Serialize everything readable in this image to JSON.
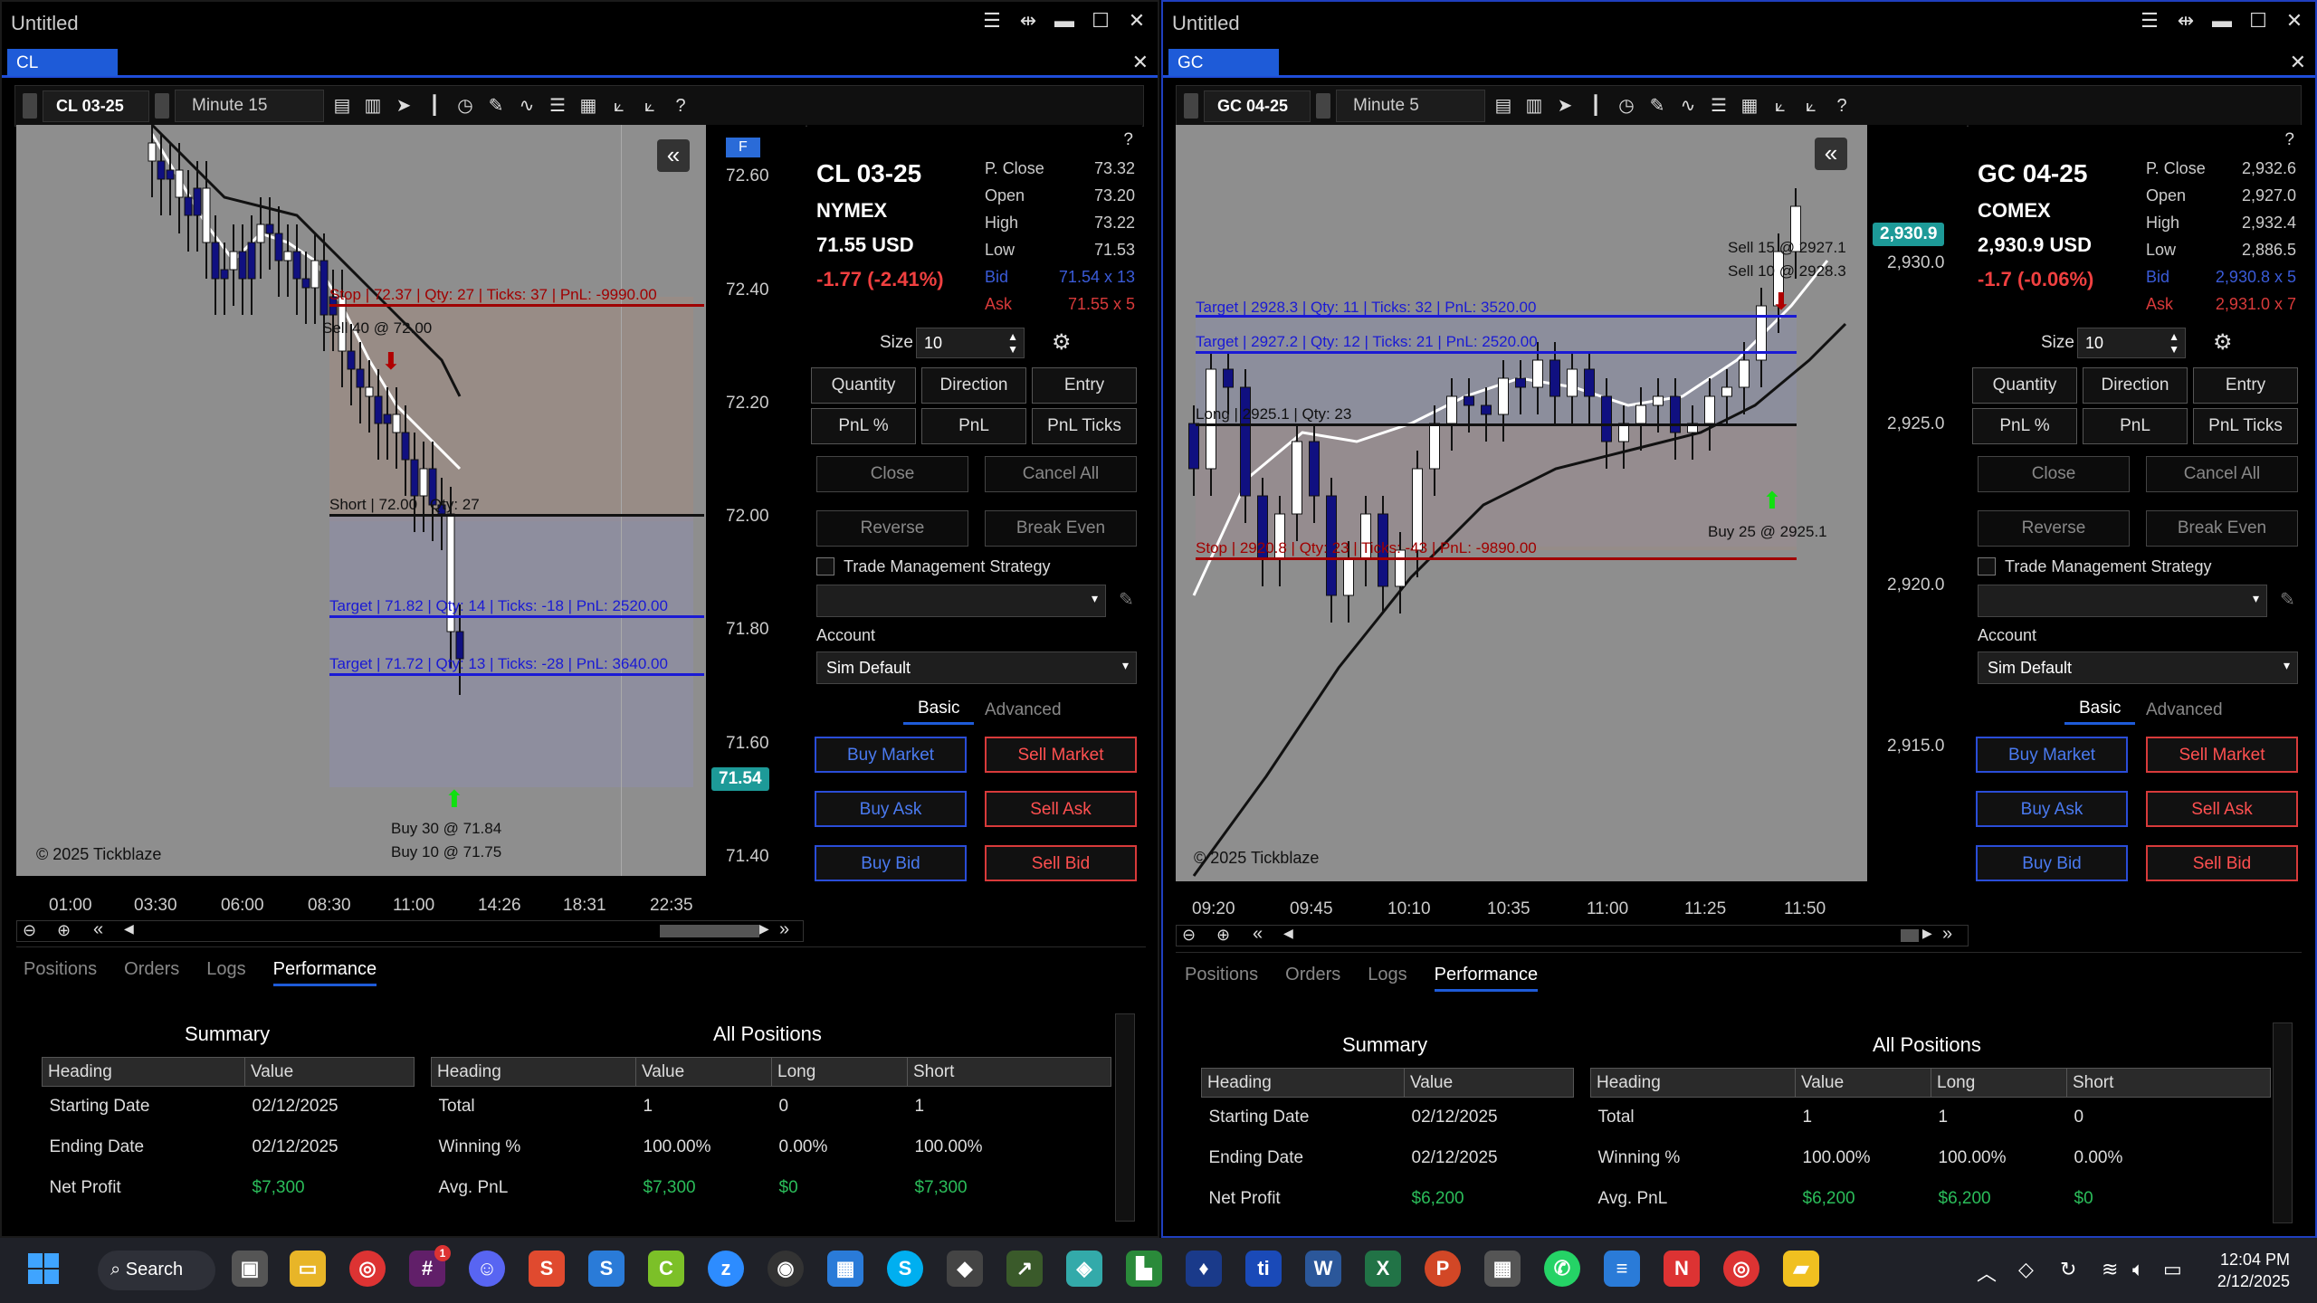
{
  "left": {
    "title": "Untitled",
    "tab": "CL",
    "instrument": "CL 03-25",
    "timeframe": "Minute 15",
    "chart": {
      "f_button": "F",
      "y_ticks": [
        "72.60",
        "72.40",
        "72.20",
        "72.00",
        "71.80",
        "71.60",
        "71.40"
      ],
      "x_ticks": [
        "01:00",
        "03:30",
        "06:00",
        "08:30",
        "11:00",
        "14:26",
        "18:31",
        "22:35"
      ],
      "price_tag": "71.54",
      "copyright": "© 2025 Tickblaze",
      "stop_label": "Stop | 72.37 | Qty: 27 | Ticks: 37 | PnL: -9990.00",
      "sell_label": "Sell 40 @ 72.00",
      "short_label": "Short | 72.00 | Qty: 27",
      "target1_label": "Target | 71.82 | Qty: 14 | Ticks: -18 | PnL: 2520.00",
      "target2_label": "Target | 71.72 | Qty: 13 | Ticks: -28 | PnL: 3640.00",
      "buy1_label": "Buy 30 @ 71.84",
      "buy2_label": "Buy 10 @ 71.75"
    },
    "panel": {
      "symbol": "CL 03-25",
      "exchange": "NYMEX",
      "price": "71.55 USD",
      "change": "-1.77 (-2.41%)",
      "quotes": [
        {
          "k": "P. Close",
          "v": "73.32"
        },
        {
          "k": "Open",
          "v": "73.20"
        },
        {
          "k": "High",
          "v": "73.22"
        },
        {
          "k": "Low",
          "v": "71.53"
        },
        {
          "k": "Bid",
          "v": "71.54 x 13"
        },
        {
          "k": "Ask",
          "v": "71.55 x 5"
        }
      ],
      "size_label": "Size",
      "size_value": "10",
      "account_value": "Sim Default"
    },
    "bottom": {
      "summary_rows": [
        {
          "h": "Starting Date",
          "v": "02/12/2025"
        },
        {
          "h": "Ending Date",
          "v": "02/12/2025"
        },
        {
          "h": "Net Profit",
          "v": "$7,300"
        }
      ],
      "positions_rows": [
        {
          "h": "Total",
          "v": "1",
          "l": "0",
          "s": "1"
        },
        {
          "h": "Winning %",
          "v": "100.00%",
          "l": "0.00%",
          "s": "100.00%"
        },
        {
          "h": "Avg. PnL",
          "v": "$7,300",
          "l": "$0",
          "s": "$7,300"
        }
      ]
    }
  },
  "right": {
    "title": "Untitled",
    "tab": "GC",
    "instrument": "GC 04-25",
    "timeframe": "Minute 5",
    "chart": {
      "y_ticks": [
        "2,930.0",
        "2,925.0",
        "2,920.0",
        "2,915.0"
      ],
      "x_ticks": [
        "09:20",
        "09:45",
        "10:10",
        "10:35",
        "11:00",
        "11:25",
        "11:50"
      ],
      "price_tag": "2,930.9",
      "copyright": "© 2025 Tickblaze",
      "sell15_label": "Sell 15 @ 2927.1",
      "sell10_label": "Sell 10 @ 2928.3",
      "target1_label": "Target | 2928.3 | Qty: 11 | Ticks: 32 | PnL: 3520.00",
      "target2_label": "Target | 2927.2 | Qty: 12 | Ticks: 21 | PnL: 2520.00",
      "long_label": "Long | 2925.1 | Qty: 23",
      "stop_label": "Stop | 2920.8 | Qty: 23 | Ticks: -43 | PnL: -9890.00",
      "buy_label": "Buy 25 @ 2925.1"
    },
    "panel": {
      "symbol": "GC 04-25",
      "exchange": "COMEX",
      "price": "2,930.9 USD",
      "change": "-1.7 (-0.06%)",
      "quotes": [
        {
          "k": "P. Close",
          "v": "2,932.6"
        },
        {
          "k": "Open",
          "v": "2,927.0"
        },
        {
          "k": "High",
          "v": "2,932.4"
        },
        {
          "k": "Low",
          "v": "2,886.5"
        },
        {
          "k": "Bid",
          "v": "2,930.8 x 5"
        },
        {
          "k": "Ask",
          "v": "2,931.0 x 7"
        }
      ],
      "size_label": "Size",
      "size_value": "10",
      "account_value": "Sim Default"
    },
    "bottom": {
      "summary_rows": [
        {
          "h": "Starting Date",
          "v": "02/12/2025"
        },
        {
          "h": "Ending Date",
          "v": "02/12/2025"
        },
        {
          "h": "Net Profit",
          "v": "$6,200"
        }
      ],
      "positions_rows": [
        {
          "h": "Total",
          "v": "1",
          "l": "1",
          "s": "0"
        },
        {
          "h": "Winning %",
          "v": "100.00%",
          "l": "100.00%",
          "s": "0.00%"
        },
        {
          "h": "Avg. PnL",
          "v": "$6,200",
          "l": "$6,200",
          "s": "$0"
        }
      ]
    }
  },
  "common": {
    "help": "?",
    "buttons": {
      "quantity": "Quantity",
      "direction": "Direction",
      "entry": "Entry",
      "pnl_pct": "PnL %",
      "pnl": "PnL",
      "pnl_ticks": "PnL Ticks",
      "close": "Close",
      "cancel_all": "Cancel All",
      "reverse": "Reverse",
      "break_even": "Break Even",
      "buy_market": "Buy Market",
      "sell_market": "Sell Market",
      "buy_ask": "Buy Ask",
      "sell_ask": "Sell Ask",
      "buy_bid": "Buy Bid",
      "sell_bid": "Sell Bid"
    },
    "tms_label": "Trade Management Strategy",
    "account_label": "Account",
    "tab_basic": "Basic",
    "tab_advanced": "Advanced",
    "bottom_tabs": [
      "Positions",
      "Orders",
      "Logs",
      "Performance"
    ],
    "summary_title": "Summary",
    "all_positions_title": "All Positions",
    "col_heading": "Heading",
    "col_value": "Value",
    "col_long": "Long",
    "col_short": "Short"
  },
  "taskbar": {
    "search": "Search",
    "time": "12:04 PM",
    "date": "2/12/2025",
    "badge": "1"
  }
}
